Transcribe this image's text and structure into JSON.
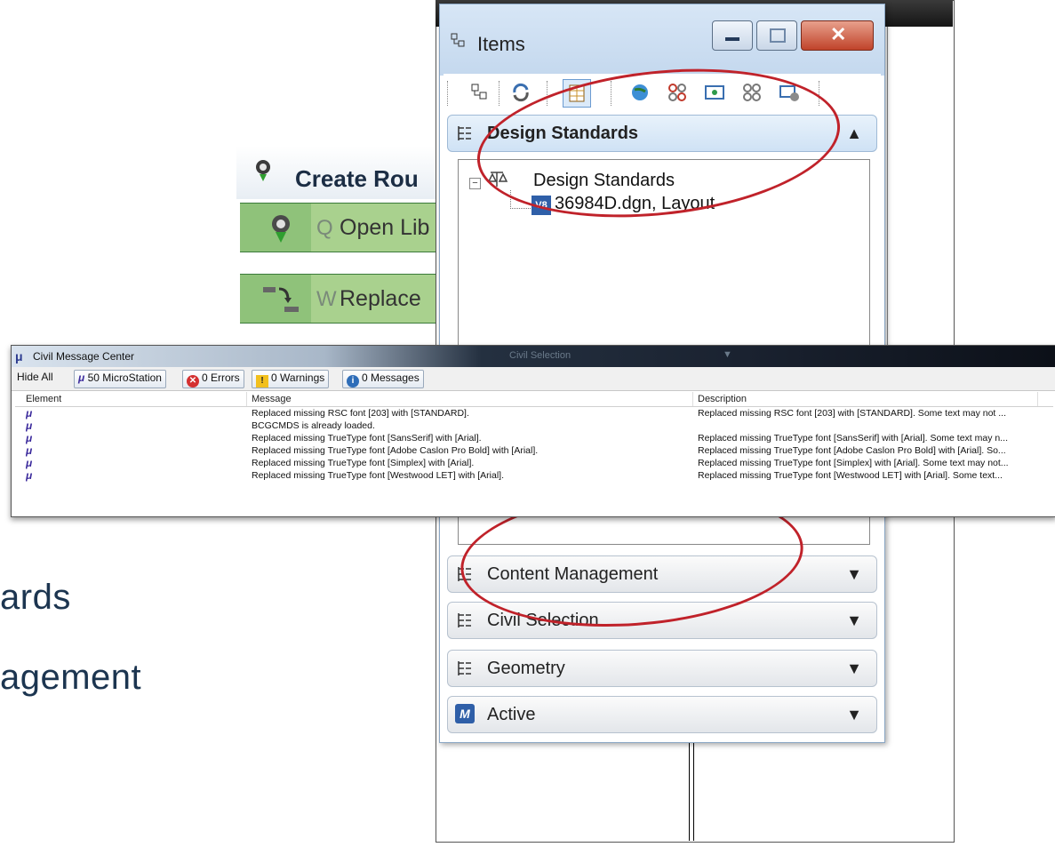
{
  "slide": {
    "line1": "ards",
    "line2": "agement"
  },
  "route_panel": {
    "title": "Create Rou",
    "items": [
      {
        "key": "Q",
        "label": "Open Lib"
      },
      {
        "key": "W",
        "label": "Replace"
      }
    ]
  },
  "items_window": {
    "title": "Items",
    "toolbar_icons": [
      "items-tree-icon",
      "refresh-icon",
      "grid-view-icon",
      "globe-icon",
      "link-icon",
      "view-icon",
      "connections-icon",
      "settings-icon"
    ],
    "design_standards": {
      "header": "Design Standards",
      "tree_root": "Design Standards",
      "tree_child": "36984D.dgn, Layout"
    },
    "panels": [
      {
        "label": "Content Management",
        "icon": "tree-icon"
      },
      {
        "label": "Civil Selection",
        "icon": "tree-icon"
      },
      {
        "label": "Geometry",
        "icon": "tree-icon"
      },
      {
        "label": "Active",
        "icon": "microstation-icon"
      }
    ]
  },
  "message_center": {
    "title": "Civil Message Center",
    "background_dropdown": "Civil Selection",
    "buttons": {
      "hide_all": "Hide All",
      "microstation": "50 MicroStation",
      "errors": "0 Errors",
      "warnings": "0 Warnings",
      "messages": "0 Messages"
    },
    "columns": [
      "Element",
      "Message",
      "Description"
    ],
    "rows": [
      {
        "message": "Replaced missing RSC font [203] with [STANDARD].",
        "description": "Replaced missing RSC font [203] with [STANDARD]. Some text may not ..."
      },
      {
        "message": "BCGCMDS is already loaded.",
        "description": ""
      },
      {
        "message": "Replaced missing TrueType font [SansSerif] with [Arial].",
        "description": "Replaced missing TrueType font [SansSerif] with [Arial]. Some text may n..."
      },
      {
        "message": "Replaced missing TrueType font [Adobe Caslon Pro Bold] with [Arial].",
        "description": "Replaced missing TrueType font [Adobe Caslon Pro Bold] with [Arial]. So..."
      },
      {
        "message": "Replaced missing TrueType font [Simplex] with [Arial].",
        "description": "Replaced missing TrueType font [Simplex] with [Arial]. Some text may not..."
      },
      {
        "message": "Replaced missing TrueType font [Westwood LET] with [Arial].",
        "description": "Replaced missing TrueType font [Westwood LET] with [Arial]. Some text..."
      }
    ]
  },
  "colors": {
    "annotation_ellipse": "#c0222a",
    "route_green": "#a9d18e",
    "slide_text": "#1c3550"
  }
}
